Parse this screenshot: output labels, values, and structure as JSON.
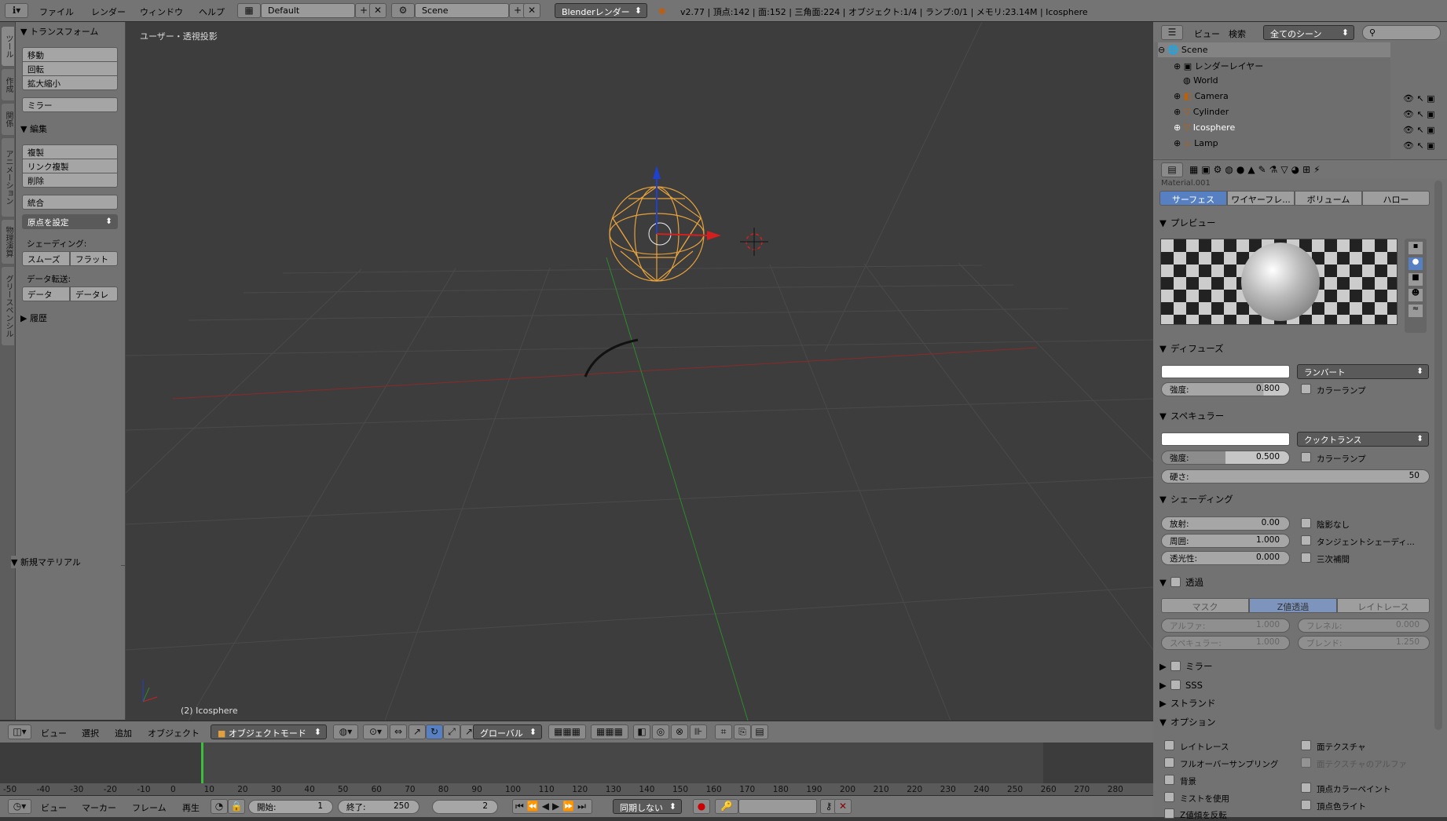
{
  "topbar": {
    "menus": [
      "ファイル",
      "レンダー",
      "ウィンドウ",
      "ヘルプ"
    ],
    "layout": "Default",
    "scene": "Scene",
    "engine": "Blenderレンダー",
    "stats": "v2.77 | 頂点:142 | 面:152 | 三角面:224 | オブジェクト:1/4 | ランプ:0/1 | メモリ:23.14M | Icosphere"
  },
  "tabs": [
    "ツール",
    "作成",
    "関係",
    "アニメーション",
    "物理演算",
    "グリースペンシル"
  ],
  "toolpanel": {
    "transform_header": "トランスフォーム",
    "transform": [
      "移動",
      "回転",
      "拡大縮小"
    ],
    "mirror": "ミラー",
    "edit_header": "編集",
    "edit": [
      "複製",
      "リンク複製",
      "削除"
    ],
    "join": "統合",
    "origin": "原点を設定",
    "shading_label": "シェーディング:",
    "smooth": "スムーズ",
    "flat": "フラット",
    "datatransfer_label": "データ転送:",
    "data": "データ",
    "datalayer": "データレ",
    "history": "履歴",
    "new_material": "新規マテリアル"
  },
  "viewport": {
    "label": "ユーザー・透視投影",
    "object": "(2) Icosphere"
  },
  "outliner": {
    "menu": [
      "ビュー",
      "検索"
    ],
    "filter": "全てのシーン",
    "items": [
      {
        "label": "Scene"
      },
      {
        "label": "レンダーレイヤー"
      },
      {
        "label": "World"
      },
      {
        "label": "Camera"
      },
      {
        "label": "Cylinder"
      },
      {
        "label": "Icosphere"
      },
      {
        "label": "Lamp"
      }
    ]
  },
  "props": {
    "material_name": "Material.001",
    "tabs": [
      "サーフェス",
      "ワイヤーフレ...",
      "ボリューム",
      "ハロー"
    ],
    "preview": "プレビュー",
    "diffuse": "ディフューズ",
    "diffuse_shader": "ランバート",
    "diffuse_intensity_label": "強度:",
    "diffuse_intensity": "0.800",
    "colorramp": "カラーランプ",
    "specular": "スペキュラー",
    "specular_shader": "クックトランス",
    "specular_intensity_label": "強度:",
    "specular_intensity": "0.500",
    "hardness_label": "硬さ:",
    "hardness": "50",
    "shading": "シェーディング",
    "emit_label": "放射:",
    "emit": "0.00",
    "ambient_label": "周囲:",
    "ambient": "1.000",
    "translucency_label": "透光性:",
    "translucency": "0.000",
    "shadeless": "陰影なし",
    "tangent": "タンジェントシェーディ...",
    "cubic": "三次補間",
    "transparency": "透過",
    "trans_modes": [
      "マスク",
      "Z値透過",
      "レイトレース"
    ],
    "alpha_label": "アルファ:",
    "alpha": "1.000",
    "fresnel_label": "フレネル:",
    "fresnel": "0.000",
    "spec_label": "スペキュラー:",
    "spec": "1.000",
    "blend_label": "ブレンド:",
    "blend": "1.250",
    "mirror": "ミラー",
    "sss": "SSS",
    "strand": "ストランド",
    "options": "オプション",
    "opt": [
      "レイトレース",
      "フルオーバーサンプリング",
      "背景",
      "ミストを使用",
      "Z値傾を反転"
    ],
    "opt2": [
      "面テクスチャ",
      "面テクスチャのアルファ",
      "頂点カラーペイント",
      "頂点色ライト"
    ]
  },
  "vbar": {
    "menus": [
      "ビュー",
      "選択",
      "追加",
      "オブジェクト"
    ],
    "mode": "オブジェクトモード",
    "orientation": "グローバル"
  },
  "timeline": {
    "ticks": [
      "-50",
      "-40",
      "-30",
      "-20",
      "-10",
      "0",
      "10",
      "20",
      "30",
      "40",
      "50",
      "60",
      "70",
      "80",
      "90",
      "100",
      "110",
      "120",
      "130",
      "140",
      "150",
      "160",
      "170",
      "180",
      "190",
      "200",
      "210",
      "220",
      "230",
      "240",
      "250",
      "260",
      "270",
      "280"
    ]
  },
  "tlbar": {
    "menus": [
      "ビュー",
      "マーカー",
      "フレーム",
      "再生"
    ],
    "start_label": "開始:",
    "start": "1",
    "end_label": "終了:",
    "end": "250",
    "current": "2",
    "sync": "同期しない"
  }
}
